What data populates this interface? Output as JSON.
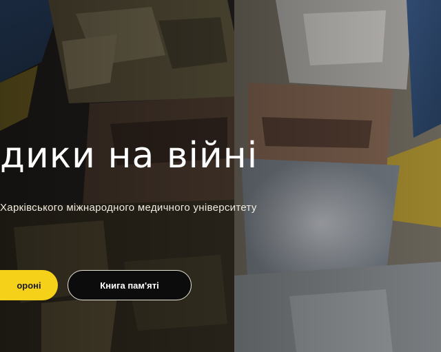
{
  "hero": {
    "headline": "дики на війні",
    "subtitle": "Харківського міжнародного медичного університету",
    "primary_button_label": "ороні",
    "secondary_button_label": "Книга пам'яті"
  },
  "colors": {
    "accent": "#f6d11a",
    "text": "#ffffff",
    "dark": "#0d0c0c"
  }
}
